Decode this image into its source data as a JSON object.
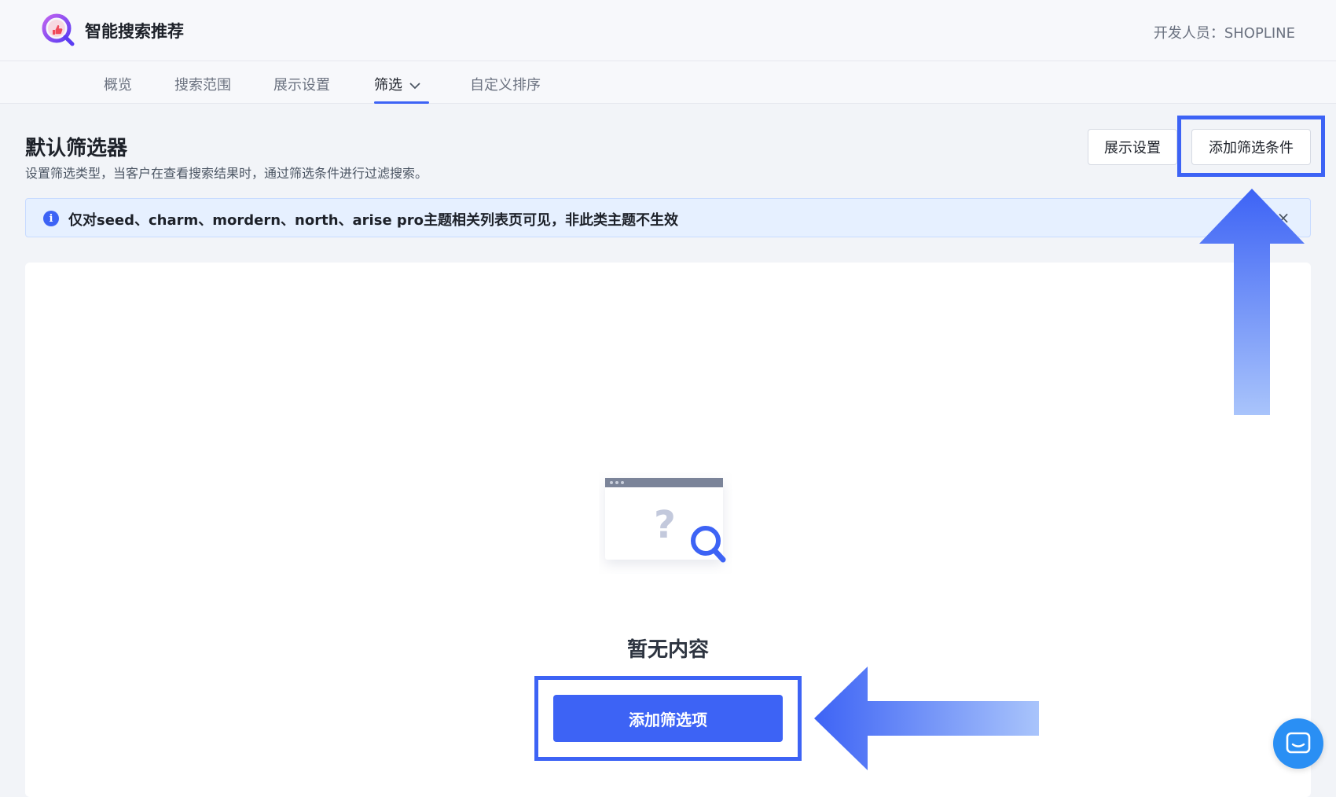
{
  "header": {
    "app_title": "智能搜索推荐",
    "developer": "开发人员：SHOPLINE"
  },
  "tabs": [
    {
      "label": "概览"
    },
    {
      "label": "搜索范围"
    },
    {
      "label": "展示设置"
    },
    {
      "label": "筛选",
      "active": true
    },
    {
      "label": "自定义排序"
    }
  ],
  "page": {
    "title": "默认筛选器",
    "description": "设置筛选类型，当客户在查看搜索结果时，通过筛选条件进行过滤搜索。"
  },
  "actions": {
    "display_settings": "展示设置",
    "add_filter_condition": "添加筛选条件"
  },
  "notice": {
    "text": "仅对seed、charm、mordern、north、arise pro主题相关列表页可见，非此类主题不生效",
    "close": "×"
  },
  "empty": {
    "text": "暂无内容",
    "button": "添加筛选项"
  },
  "colors": {
    "accent": "#3d63f5",
    "notice_bg": "#e6f0ff",
    "chat": "#2a8ff4"
  },
  "icons": {
    "logo": "search-like-logo-icon",
    "info": "info-icon",
    "close": "close-icon",
    "chevron": "chevron-down-icon",
    "chat": "chat-bubble-icon"
  }
}
